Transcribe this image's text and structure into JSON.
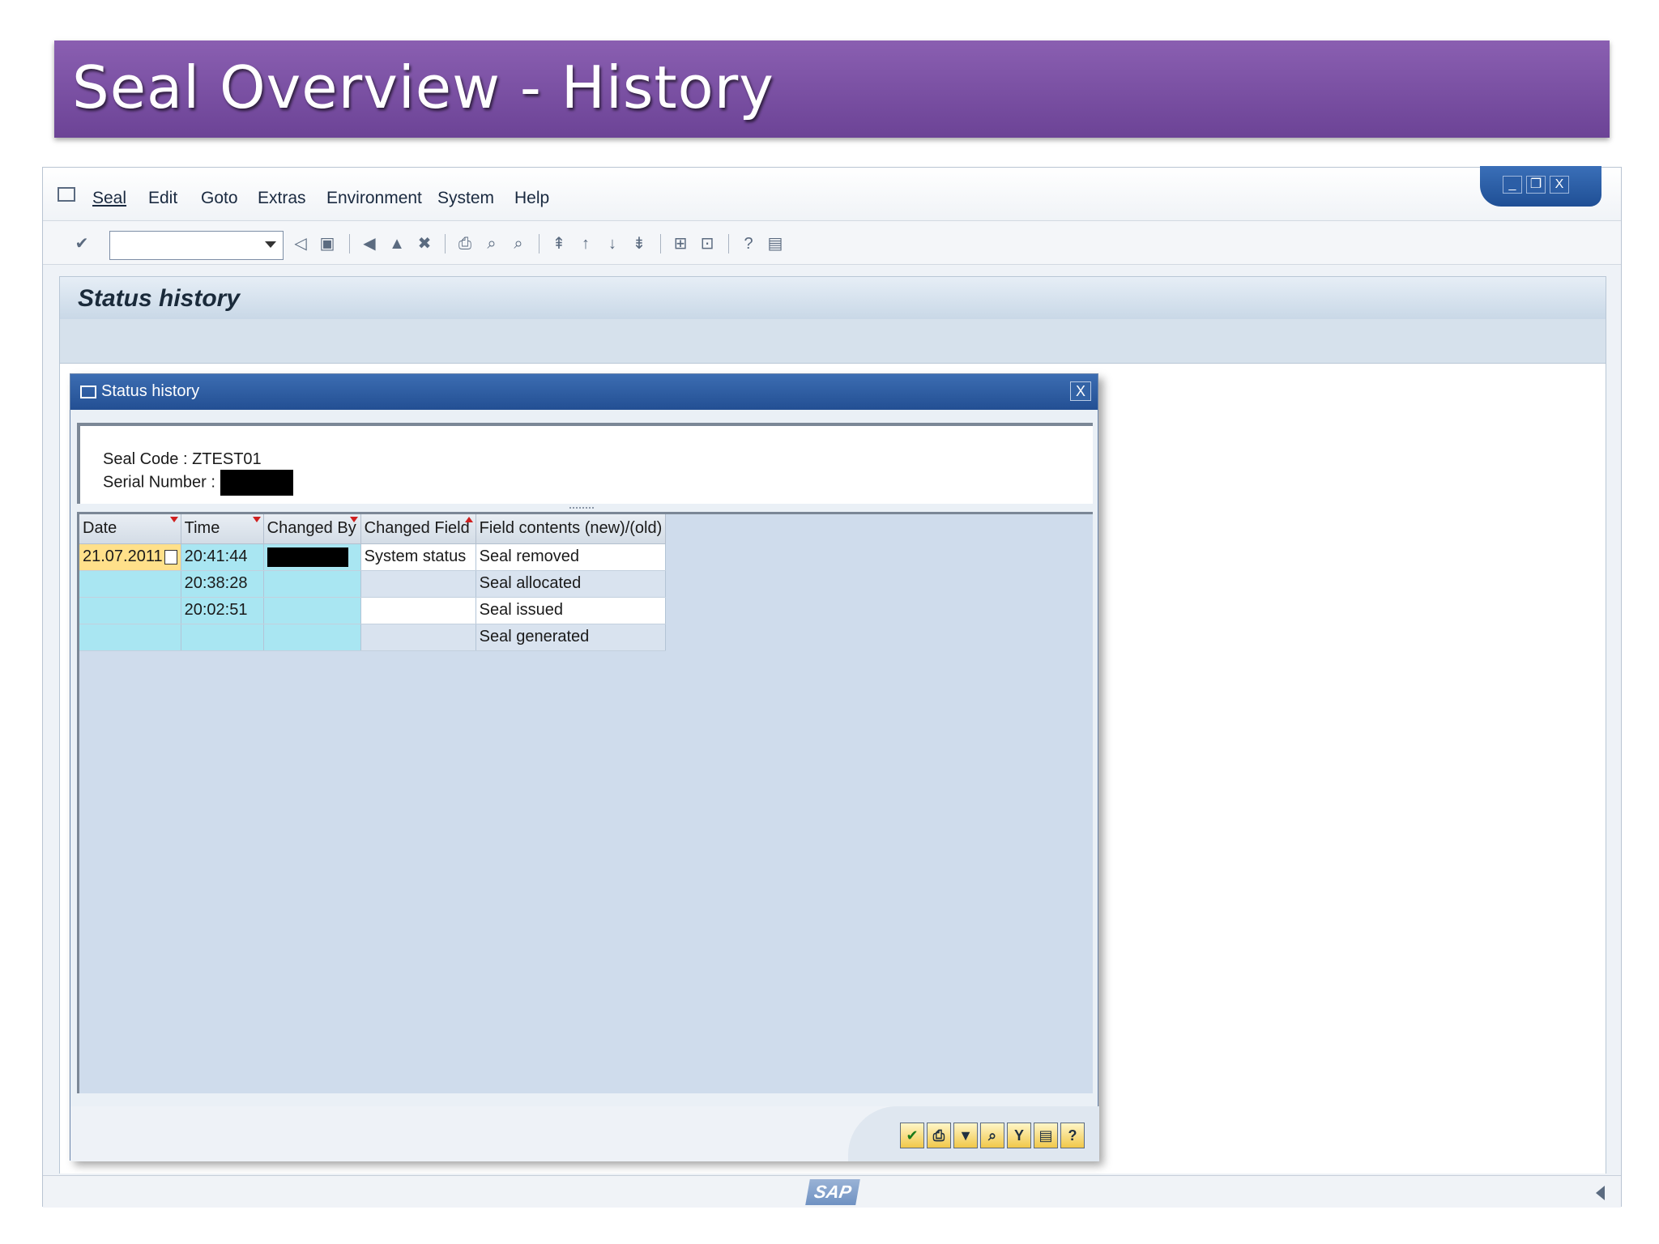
{
  "slide": {
    "title": "Seal Overview - History"
  },
  "menu": [
    "Seal",
    "Edit",
    "Goto",
    "Extras",
    "Environment",
    "System",
    "Help"
  ],
  "window_controls": {
    "minimize": "_",
    "restore": "❐",
    "close": "X"
  },
  "screen_title": "Status history",
  "dialog": {
    "title": "Status history",
    "close": "X",
    "seal_code_label": "Seal Code : ",
    "seal_code_value": "ZTEST01",
    "serial_number_label": "Serial Number : "
  },
  "grid": {
    "columns": [
      "Date",
      "Time",
      "Changed By",
      "Changed Field",
      "Field contents (new)/(old)"
    ],
    "rows": [
      {
        "date": "21.07.2011",
        "time": "20:41:44",
        "changed_by": "",
        "field": "System status",
        "contents": "Seal removed"
      },
      {
        "date": "",
        "time": "20:38:28",
        "changed_by": "",
        "field": "",
        "contents": "Seal allocated"
      },
      {
        "date": "",
        "time": "20:02:51",
        "changed_by": "",
        "field": "",
        "contents": "Seal issued"
      },
      {
        "date": "",
        "time": "",
        "changed_by": "",
        "field": "",
        "contents": "Seal generated"
      }
    ]
  },
  "footer_buttons": [
    "continue-check-icon",
    "print-icon",
    "sort-icon",
    "find-icon",
    "filter-icon",
    "export-icon",
    "help-icon"
  ],
  "brand": {
    "logo": "SAP"
  }
}
